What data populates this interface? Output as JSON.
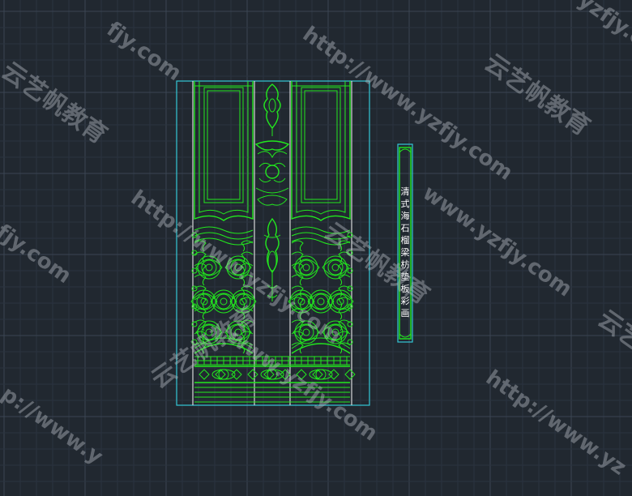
{
  "drawing": {
    "title": "清式海石榴梁枋垫板彩画"
  },
  "watermarks": {
    "brand": "云艺帆教育",
    "url_full": "http://www.yzfjy.com",
    "url_short": "www.yzfjy.com",
    "url_prefix": "http://www.yz",
    "url_tail": "fjy.com",
    "url_www": "p://www.y",
    "url_end": "yzfjy.com"
  },
  "colors": {
    "background": "#212830",
    "frame": "#33c8d6",
    "ornament": "#22e81e",
    "divider": "#e8e8e8"
  }
}
